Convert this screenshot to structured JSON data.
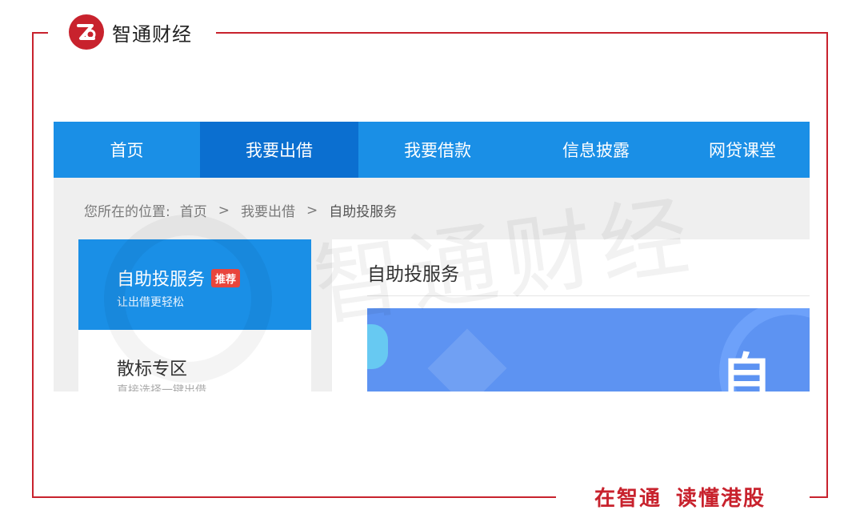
{
  "brand": {
    "name": "智通财经",
    "logo_icon": "zhitong-logo-icon",
    "accent": "#c8222d"
  },
  "slogan": {
    "part1": "在智通",
    "part2": "读懂港股"
  },
  "nav": {
    "items": [
      {
        "label": "首页"
      },
      {
        "label": "我要出借"
      },
      {
        "label": "我要借款"
      },
      {
        "label": "信息披露"
      },
      {
        "label": "网贷课堂"
      }
    ],
    "active_index": 1,
    "color": "#1a8fe6",
    "active_color": "#0b6fd0"
  },
  "breadcrumb": {
    "prefix": "您所在的位置:",
    "items": [
      "首页",
      "我要出借",
      "自助投服务"
    ],
    "separator": ">"
  },
  "sidebar": {
    "active": {
      "title": "自助投服务",
      "badge": "推荐",
      "subtitle": "让出借更轻松"
    },
    "items": [
      {
        "title": "散标专区",
        "subtitle": "直接选择一键出借"
      }
    ]
  },
  "content": {
    "title": "自助投服务",
    "banner_text": "自助"
  },
  "watermark": {
    "text": "智通财经"
  }
}
